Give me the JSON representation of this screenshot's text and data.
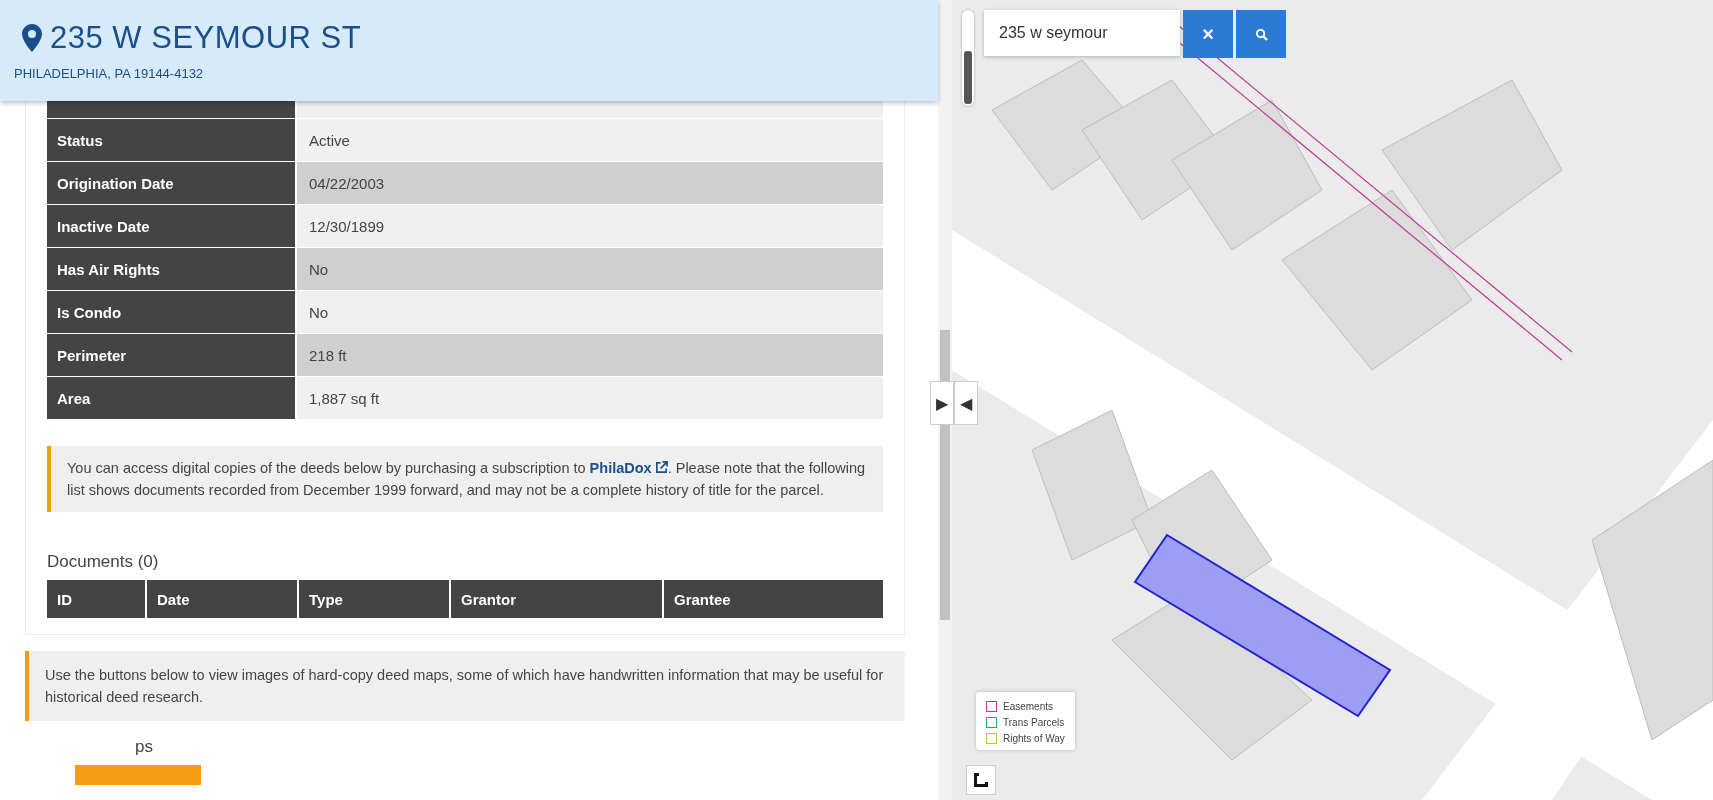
{
  "header": {
    "title": "235 W SEYMOUR ST",
    "subtitle": "PHILADELPHIA, PA 19144-4132"
  },
  "parcel_table": [
    {
      "label": "Status",
      "value": "Active"
    },
    {
      "label": "Origination Date",
      "value": "04/22/2003"
    },
    {
      "label": "Inactive Date",
      "value": "12/30/1899"
    },
    {
      "label": "Has Air Rights",
      "value": "No"
    },
    {
      "label": "Is Condo",
      "value": "No"
    },
    {
      "label": "Perimeter",
      "value": "218 ft"
    },
    {
      "label": "Area",
      "value": "1,887 sq ft"
    }
  ],
  "deeds_notice": {
    "before": "You can access digital copies of the deeds below by purchasing a subscription to ",
    "link": "PhilaDox",
    "after": ". Please note that the following list shows documents recorded from December 1999 forward, and may not be a complete history of title for the parcel."
  },
  "documents": {
    "title": "Documents (0)",
    "columns": [
      "ID",
      "Date",
      "Type",
      "Grantor",
      "Grantee"
    ]
  },
  "deed_maps_notice": "Use the buttons below to view images of hard-copy deed maps, some of which have handwritten information that may be useful for historical deed research.",
  "deed_maps_heading": "ps",
  "panel_toggle": {
    "expand": "▶",
    "collapse": "◀"
  },
  "map": {
    "zoom_slider": {
      "level": 0.55
    },
    "search_value": "235 w seymour",
    "clear_label": "×",
    "legend": [
      {
        "label": "Easements",
        "color": "#c0399a"
      },
      {
        "label": "Trans Parcels",
        "color": "#2a9d8f"
      },
      {
        "label": "Rights of Way",
        "color": "#d4b84a"
      }
    ]
  }
}
